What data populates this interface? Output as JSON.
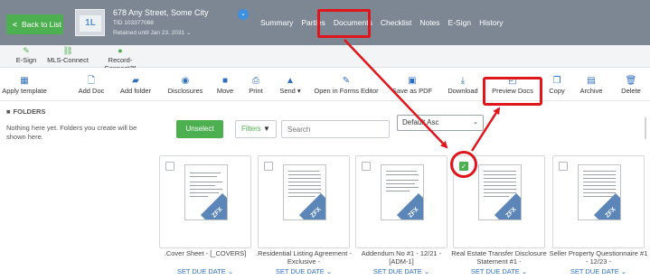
{
  "header": {
    "back_label": "Back to List",
    "home_glyph": "1L",
    "address": "678 Any Street, Some City",
    "tid": "TID 103377088",
    "retained": "Retained until Jan 23, 2031 ⌄",
    "info_glyph": "⌄",
    "tabs": [
      "Summary",
      "Parties",
      "Documents",
      "Checklist",
      "Notes",
      "E-Sign",
      "History"
    ],
    "active_tab": "Documents"
  },
  "subbar": {
    "items": [
      {
        "label": "E-Sign",
        "icon": "pen-icon"
      },
      {
        "label": "MLS-Connect",
        "icon": "link-icon"
      },
      {
        "label": "Record-Connect™",
        "icon": "record-icon"
      }
    ]
  },
  "toolbar": {
    "items": [
      {
        "label": "Apply template",
        "icon": "template-icon"
      },
      {
        "label": "Add Doc",
        "icon": "add-doc-icon"
      },
      {
        "label": "Add folder",
        "icon": "add-folder-icon"
      },
      {
        "label": "Disclosures",
        "icon": "disclosures-icon"
      },
      {
        "label": "Move",
        "icon": "move-icon"
      },
      {
        "label": "Print",
        "icon": "print-icon"
      },
      {
        "label": "Send ▾",
        "icon": "send-icon"
      },
      {
        "label": "Open in Forms Editor",
        "icon": "edit-icon"
      },
      {
        "label": "Save as PDF",
        "icon": "pdf-icon"
      },
      {
        "label": "Download",
        "icon": "download-icon"
      },
      {
        "label": "Preview Docs",
        "icon": "preview-icon"
      },
      {
        "label": "Copy",
        "icon": "copy-icon"
      },
      {
        "label": "Archive",
        "icon": "archive-icon"
      },
      {
        "label": "Delete",
        "icon": "delete-icon"
      }
    ]
  },
  "folders": {
    "title": "FOLDERS",
    "empty_text": "Nothing here yet. Folders you create will be shown here."
  },
  "filters": {
    "unselect_label": "Unselect",
    "filters_label": "Filters",
    "search_placeholder": "Search",
    "sort_value": "Default Asc"
  },
  "documents": [
    {
      "title": ".Cover Sheet - [_COVERS]",
      "due": "SET DUE DATE ⌄",
      "checked": false
    },
    {
      "title": ".Residential Listing Agreement - Exclusive -",
      "due": "SET DUE DATE ⌄",
      "checked": false
    },
    {
      "title": "Addendum No #1 - 12/21 - [ADM-1]",
      "due": "SET DUE DATE ⌄",
      "checked": false
    },
    {
      "title": "Real Estate Transfer Disclosure Statement #1 -",
      "due": "SET DUE DATE ⌄",
      "checked": true
    },
    {
      "title": "Seller Property Questionnaire #1 - 12/23 -",
      "due": "SET DUE DATE ⌄",
      "checked": false
    }
  ],
  "thumb_watermark": "ZFX",
  "colors": {
    "header_bg": "#7d8794",
    "accent_green": "#4caf50",
    "accent_blue": "#2f6fbd",
    "annotation_red": "#e0161d"
  }
}
